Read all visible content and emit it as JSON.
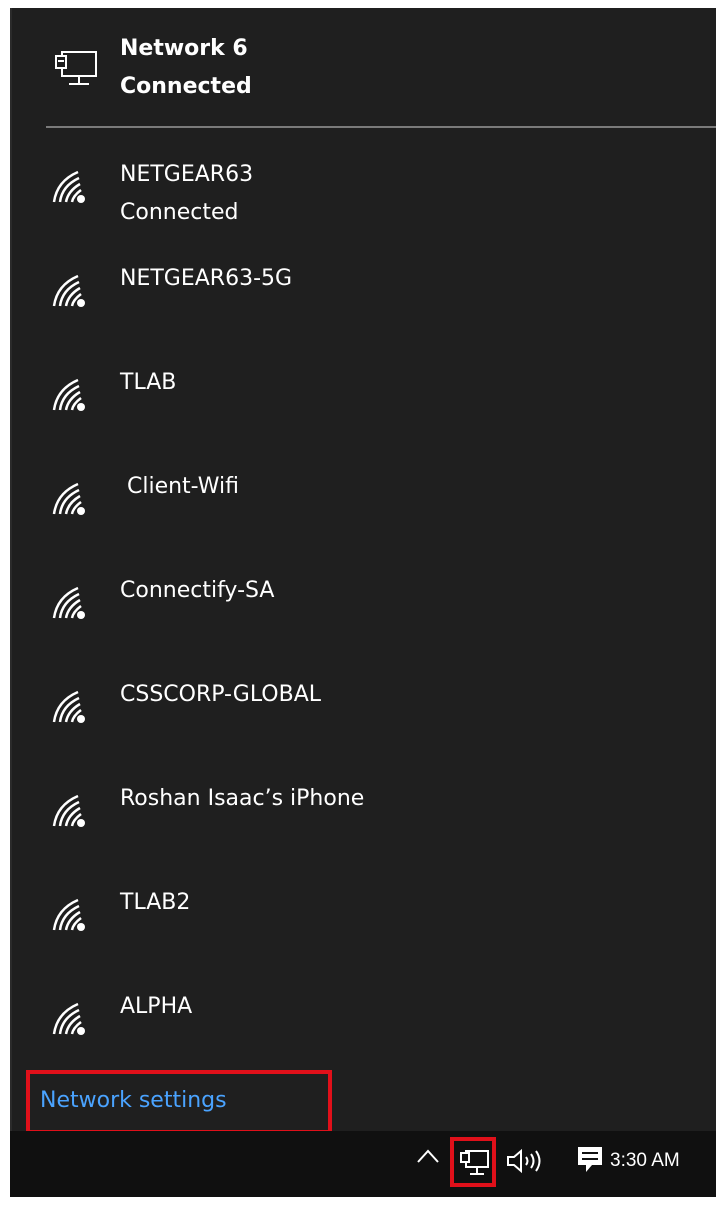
{
  "ethernet": {
    "name": "Network  6",
    "status": "Connected",
    "icon": "ethernet-icon"
  },
  "wifi": [
    {
      "name": "NETGEAR63",
      "status": "Connected",
      "icon": "wifi-signal-icon"
    },
    {
      "name": "NETGEAR63-5G",
      "icon": "wifi-signal-icon"
    },
    {
      "name": "TLAB",
      "icon": "wifi-signal-icon"
    },
    {
      "name": " Client-Wifi",
      "icon": "wifi-signal-icon"
    },
    {
      "name": "Connectify-SA",
      "icon": "wifi-signal-icon"
    },
    {
      "name": "CSSCORP-GLOBAL",
      "icon": "wifi-signal-icon"
    },
    {
      "name": "Roshan Isaac’s iPhone",
      "icon": "wifi-signal-icon"
    },
    {
      "name": "TLAB2",
      "icon": "wifi-signal-icon"
    },
    {
      "name": "ALPHA",
      "icon": "wifi-signal-icon"
    }
  ],
  "settings": {
    "label": "Network settings"
  },
  "taskbar": {
    "time": "3:30 AM",
    "icons": [
      "chevron-up-icon",
      "network-icon",
      "volume-icon",
      "action-center-icon"
    ]
  },
  "colors": {
    "flyout_bg": "#1f1f1f",
    "taskbar_bg": "#101010",
    "link": "#4aa3ff",
    "highlight": "#e0101a",
    "divider": "#7a7a7a"
  }
}
